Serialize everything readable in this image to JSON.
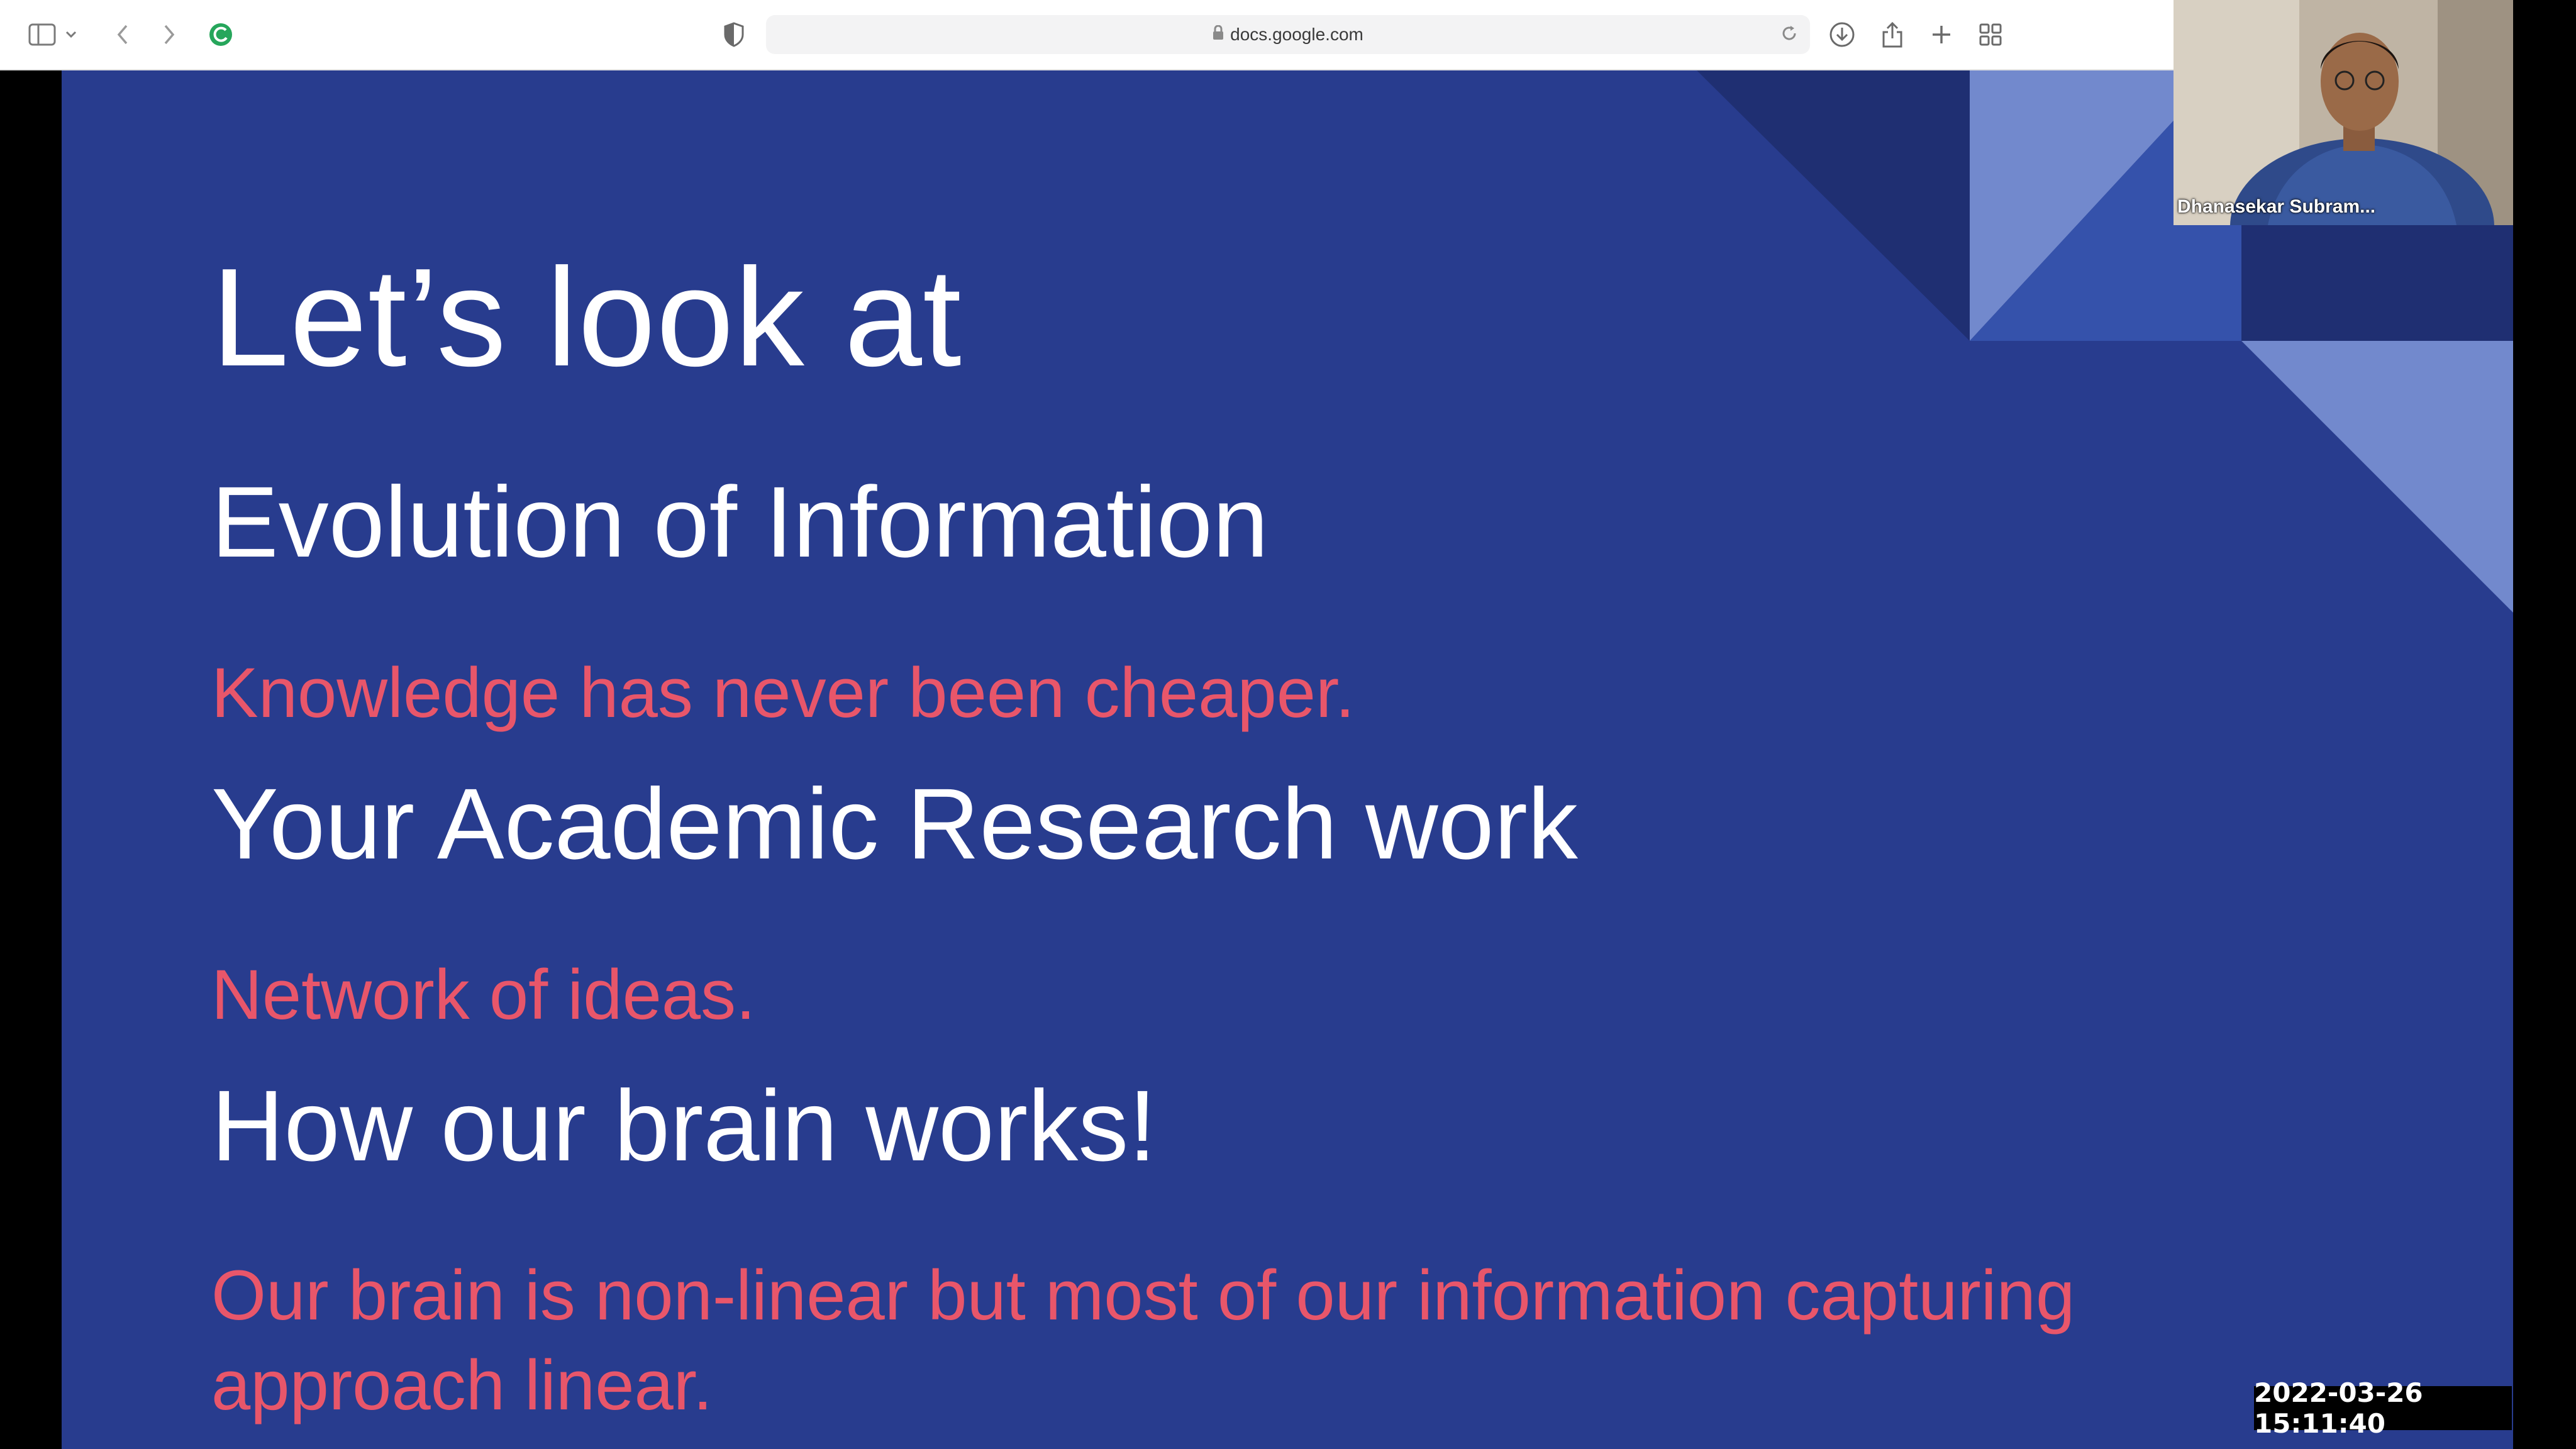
{
  "browser": {
    "url": "docs.google.com",
    "icons": {
      "sidebar": "sidebar-icon",
      "sidebar_menu": "chevron-down-icon",
      "back": "back-icon",
      "forward": "forward-icon",
      "extension": "extension-icon",
      "privacy": "shield-icon",
      "lock": "lock-icon",
      "reload": "reload-icon",
      "download": "download-icon",
      "share": "share-icon",
      "new_tab": "plus-icon",
      "tab_overview": "grid-icon"
    }
  },
  "slide": {
    "title": "Let’s look at",
    "sections": [
      {
        "heading": "Evolution of Information",
        "subtext": "Knowledge has never been cheaper."
      },
      {
        "heading": "Your Academic Research work",
        "subtext": "Network of ideas."
      },
      {
        "heading": "How our brain works!",
        "subtext": "Our brain is non-linear but most of our information capturing approach linear."
      }
    ]
  },
  "webcam": {
    "participant_name": "Dhanasekar Subram..."
  },
  "timestamp": "2022-03-26  15:11:40",
  "colors": {
    "slide_background": "#283c8e",
    "heading_text": "#ffffff",
    "subtext": "#e8566a",
    "decor_light": "#7289cd",
    "decor_dark": "#1f2f72"
  }
}
